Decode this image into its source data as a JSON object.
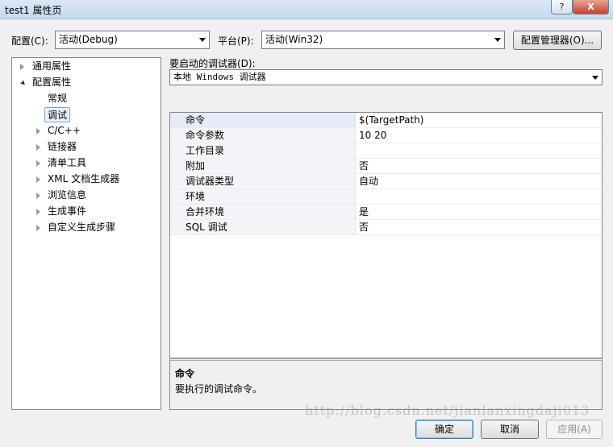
{
  "window": {
    "title": "test1 属性页",
    "help_label": "?",
    "close_label": "X"
  },
  "config": {
    "label": "配置(C):",
    "value": "活动(Debug)"
  },
  "platform": {
    "label": "平台(P):",
    "value": "活动(Win32)"
  },
  "config_manager_label": "配置管理器(O)...",
  "tree": {
    "items": [
      {
        "label": "通用属性",
        "expander": "collapsed"
      },
      {
        "label": "配置属性",
        "expander": "expanded"
      },
      {
        "label": "常规",
        "expander": "none"
      },
      {
        "label": "调试",
        "expander": "none",
        "selected": true
      },
      {
        "label": "C/C++",
        "expander": "collapsed"
      },
      {
        "label": "链接器",
        "expander": "collapsed"
      },
      {
        "label": "清单工具",
        "expander": "collapsed"
      },
      {
        "label": "XML 文档生成器",
        "expander": "collapsed"
      },
      {
        "label": "浏览信息",
        "expander": "collapsed"
      },
      {
        "label": "生成事件",
        "expander": "collapsed"
      },
      {
        "label": "自定义生成步骤",
        "expander": "collapsed"
      }
    ]
  },
  "debugger": {
    "label": "要启动的调试器(D):",
    "value": "本地 Windows 调试器"
  },
  "properties": {
    "rows": [
      {
        "name": "命令",
        "value": "$(TargetPath)"
      },
      {
        "name": "命令参数",
        "value": "10 20"
      },
      {
        "name": "工作目录",
        "value": ""
      },
      {
        "name": "附加",
        "value": "否"
      },
      {
        "name": "调试器类型",
        "value": "自动"
      },
      {
        "name": "环境",
        "value": ""
      },
      {
        "name": "合并环境",
        "value": "是"
      },
      {
        "name": "SQL 调试",
        "value": "否"
      }
    ]
  },
  "description": {
    "title": "命令",
    "text": "要执行的调试命令。"
  },
  "buttons": {
    "ok": "确定",
    "cancel": "取消",
    "apply": "应用(A)"
  },
  "watermark": "http://blog.csdn.net/jianlanxingdaji013"
}
